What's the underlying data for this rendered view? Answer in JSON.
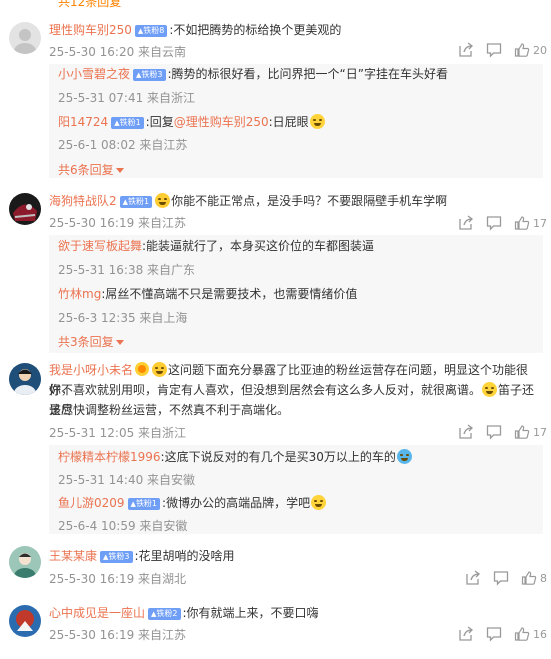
{
  "top_cut": "共12条回复",
  "comments": [
    {
      "user": "理性购车别250",
      "badge": "铁粉8",
      "text": ":不如把腾势的标给换个更美观的",
      "meta": "25-5-30 16:20 来自云南",
      "likes": "20",
      "avatar_color": "#d9d9d9",
      "replies": [
        {
          "user": "小小雪碧之夜",
          "badge": "铁粉3",
          "text": ":腾势的标很好看，比问界把一个“日”字挂在车头好看",
          "meta": "25-5-31 07:41 来自浙江"
        },
        {
          "user": "阳14724",
          "badge": "铁粉1",
          "text_pre": ":回复",
          "mention": "@理性购车别250",
          "text_post": ":日屁眼",
          "meta": "25-6-1 08:02 来自江苏"
        }
      ],
      "more": "共6条回复"
    },
    {
      "user": "海狗特战队2",
      "badge": "铁粉1",
      "text": "你能不能正常点，是没手吗？不要跟隔壁手机车学啊",
      "meta": "25-5-30 16:19 来自江苏",
      "likes": "17",
      "avatar_color": "#8b1b2b",
      "replies": [
        {
          "user": "欲于速写板起舞",
          "text": ":能装逼就行了，本身买这价位的车都图装逼",
          "meta": "25-5-31 16:38 来自广东"
        },
        {
          "user": "竹林mg",
          "text": ":屌丝不懂高端不只是需要技术，也需要情绪价值",
          "meta": "25-6-3 12:35 来自上海"
        }
      ],
      "more": "共3条回复"
    },
    {
      "user": "我是小呀小未名",
      "text_line1": "这问题下面充分暴露了比亚迪的粉丝运营存在问题，明显这个功能很好，",
      "text_line2": "你不喜欢就别用呗，肯定有人喜欢，但没想到居然会有这么多人反对，就很离谱。",
      "text_line2b": "笛子还是应",
      "text_line3": "该尽快调整粉丝运营，不然真不利于高端化。",
      "meta": "25-5-31 12:05 来自浙江",
      "likes": "17",
      "avatar_color": "#1f4e79",
      "replies": [
        {
          "user": "柠檬精本柠檬1996",
          "text": ":这底下说反对的有几个是买30万以上的车的",
          "meta": "25-5-31 14:40 来自安徽"
        },
        {
          "user": "鱼儿游0209",
          "badge": "铁粉1",
          "text": ":微博办公的高端品牌，学吧",
          "meta": "25-6-4 10:59 来自安徽"
        }
      ]
    },
    {
      "user": "王某某康",
      "badge": "铁粉3",
      "text": ":花里胡哨的没啥用",
      "meta": "25-5-30 16:19 来自湖北",
      "likes": "8",
      "avatar_color": "#3a7d6e"
    },
    {
      "user": "心中成见是一座山",
      "badge": "铁粉2",
      "text": ":你有就端上来，不要口嗨",
      "meta": "25-5-30 16:19 来自江苏",
      "likes": "16",
      "avatar_color": "#c0392b"
    }
  ],
  "colors": {
    "username": "#eb7350",
    "meta": "#939393",
    "badge": "#6f9ef7",
    "reply_bg": "#f7f7f7"
  }
}
